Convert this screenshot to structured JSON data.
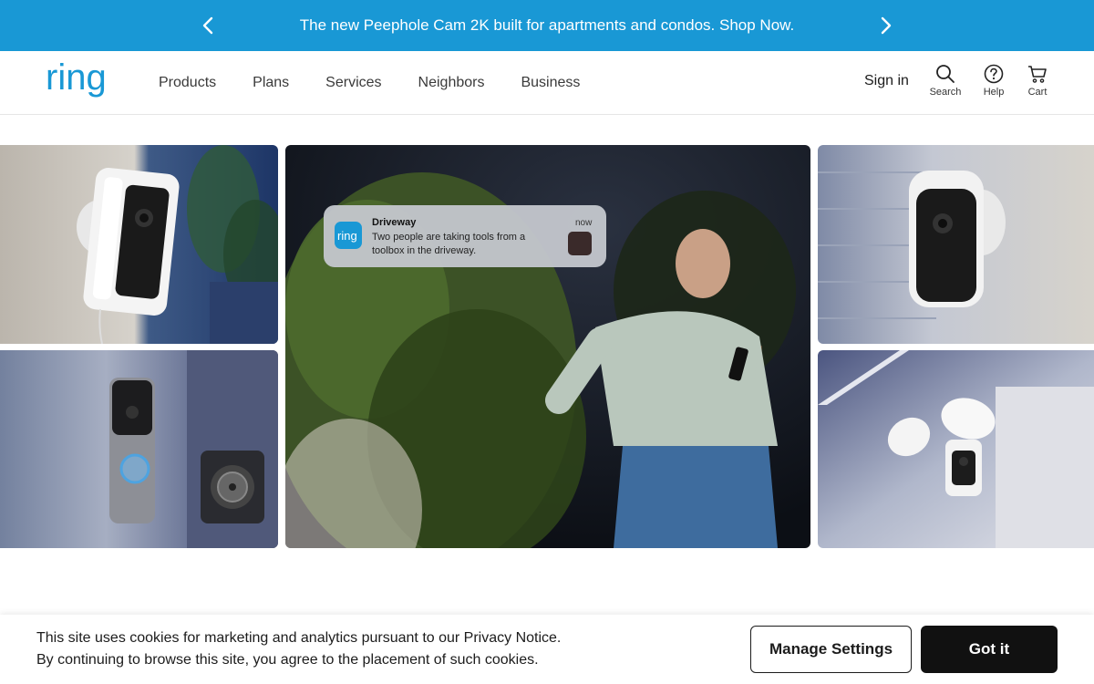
{
  "promo": {
    "text": "The new Peephole Cam 2K built for apartments and condos. Shop Now.",
    "prev_icon": "chevron-left-icon",
    "next_icon": "chevron-right-icon"
  },
  "brand": {
    "logo_text": "ring"
  },
  "nav": {
    "items": [
      {
        "label": "Products"
      },
      {
        "label": "Plans"
      },
      {
        "label": "Services"
      },
      {
        "label": "Neighbors"
      },
      {
        "label": "Business"
      }
    ],
    "sign_in": "Sign in",
    "tools": [
      {
        "label": "Search",
        "icon": "search-icon"
      },
      {
        "label": "Help",
        "icon": "help-icon"
      },
      {
        "label": "Cart",
        "icon": "cart-icon"
      }
    ]
  },
  "hero": {
    "notification": {
      "title": "Driveway",
      "time": "now",
      "line1": "Two people are taking tools from a",
      "line2": "toolbox in the driveway.",
      "app_logo": "ring"
    }
  },
  "cookie": {
    "line1": "This site uses cookies for marketing and analytics pursuant to our Privacy Notice.",
    "line2": "By continuing to browse this site, you agree to the placement of such cookies.",
    "manage_label": "Manage Settings",
    "accept_label": "Got it"
  },
  "colors": {
    "promo_bg": "#1998d5",
    "accept_bg": "#111111"
  }
}
